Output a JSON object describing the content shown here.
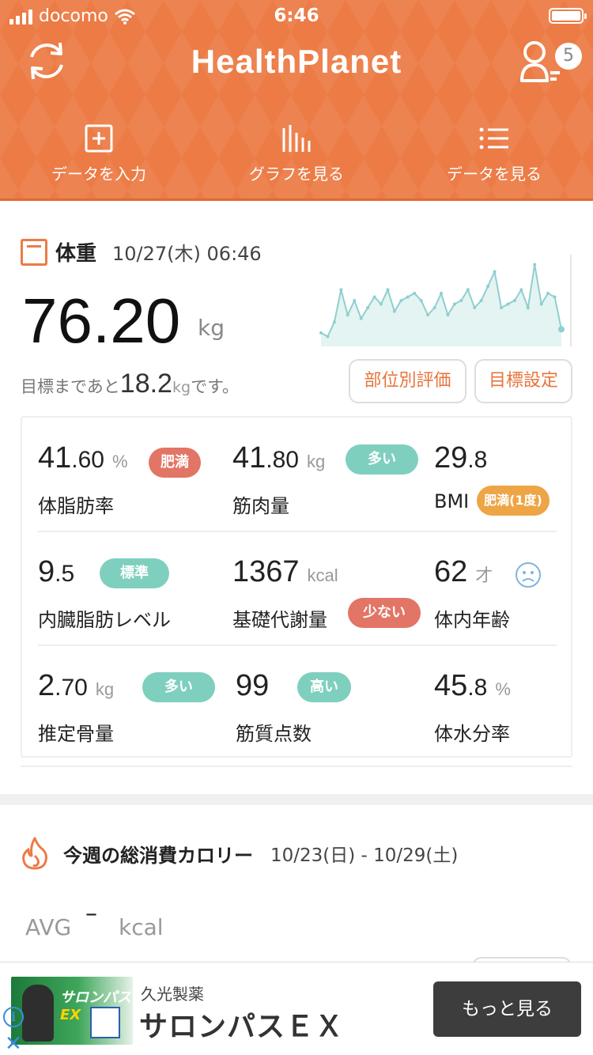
{
  "status_bar": {
    "carrier": "docomo",
    "time": "6:46"
  },
  "header": {
    "title": "HealthPlanet",
    "user_badge_count": "5",
    "tabs": [
      {
        "label": "データを入力",
        "icon": "plus-square-icon"
      },
      {
        "label": "グラフを見る",
        "icon": "bar-chart-icon"
      },
      {
        "label": "データを見る",
        "icon": "list-icon"
      }
    ]
  },
  "weight": {
    "label": "体重",
    "datetime": "10/27(木) 06:46",
    "value": "76.20",
    "unit": "kg",
    "goal_prefix": "目標まであと",
    "goal_value": "18.2",
    "goal_unit": "kg",
    "goal_suffix": "です。",
    "eval_button": "部位別評価",
    "goal_button": "目標設定",
    "trend": [
      76.1,
      76.0,
      76.4,
      77.3,
      76.6,
      77.0,
      76.5,
      76.8,
      77.1,
      76.9,
      77.3,
      76.7,
      77.0,
      77.1,
      77.2,
      77.0,
      76.6,
      76.8,
      77.2,
      76.6,
      76.9,
      77.0,
      77.3,
      76.8,
      77.0,
      77.4,
      77.8,
      76.8,
      76.9,
      77.0,
      77.3,
      76.8,
      78.0,
      76.9,
      77.2,
      77.1,
      76.2
    ]
  },
  "metrics": {
    "body_fat": {
      "int": "41",
      "dec": ".60",
      "unit": "%",
      "label": "体脂肪率",
      "badge": "肥満",
      "badge_color": "#e27565"
    },
    "muscle": {
      "int": "41",
      "dec": ".80",
      "unit": "kg",
      "label": "筋肉量",
      "badge": "多い",
      "badge_color": "#7fcfbf"
    },
    "bmi": {
      "int": "29",
      "dec": ".8",
      "label": "BMI",
      "badge": "肥満(1度)",
      "badge_color": "#eda545"
    },
    "visceral": {
      "int": "9",
      "dec": ".5",
      "label": "内臓脂肪レベル",
      "badge": "標準",
      "badge_color": "#7fcfbf"
    },
    "bmr": {
      "int": "1367",
      "unit": "kcal",
      "label": "基礎代謝量",
      "badge": "少ない",
      "badge_color": "#e27565"
    },
    "body_age": {
      "int": "62",
      "unit": "才",
      "label": "体内年齢",
      "icon": "sad-face-icon"
    },
    "bone": {
      "int": "2",
      "dec": ".70",
      "unit": "kg",
      "label": "推定骨量",
      "badge": "多い",
      "badge_color": "#7fcfbf"
    },
    "muscle_score": {
      "int": "99",
      "label": "筋質点数",
      "badge": "高い",
      "badge_color": "#7fcfbf"
    },
    "water": {
      "int": "45",
      "dec": ".8",
      "unit": "%",
      "label": "体水分率"
    }
  },
  "calories": {
    "title": "今週の総消費カロリー",
    "date_range": "10/23(日) - 10/29(土)",
    "avg_label": "AVG",
    "avg_value": "–",
    "unit": "kcal"
  },
  "ad": {
    "sponsor": "久光製薬",
    "title": "サロンパスＥＸ",
    "image_brand": "サロンパス",
    "image_brand_suffix": "EX",
    "cta": "もっと見る"
  },
  "colors": {
    "accent": "#ec7b45",
    "chart_line": "#8fcfcf",
    "chart_fill": "#e4f4f3"
  }
}
